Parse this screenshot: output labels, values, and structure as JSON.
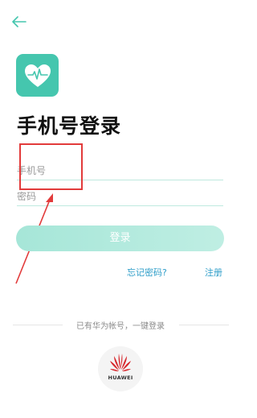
{
  "status_bar": {
    "left_text": "",
    "right_text": ""
  },
  "header": {
    "back_icon": "arrow-left-icon"
  },
  "app": {
    "logo_icon": "heart-pulse-icon",
    "brand_color": "#45c6ae"
  },
  "login": {
    "title": "手机号登录",
    "phone_placeholder": "手机号",
    "password_placeholder": "密码",
    "submit_label": "登录",
    "forgot_password_label": "忘记密码?",
    "register_label": "注册"
  },
  "third_party": {
    "hint": "已有华为帐号，一键登录",
    "huawei_label": "HUAWEI",
    "huawei_icon": "huawei-logo-icon"
  },
  "colors": {
    "accent": "#45c6ae",
    "link": "#2f9ec9",
    "annotation": "#e23b3b"
  }
}
